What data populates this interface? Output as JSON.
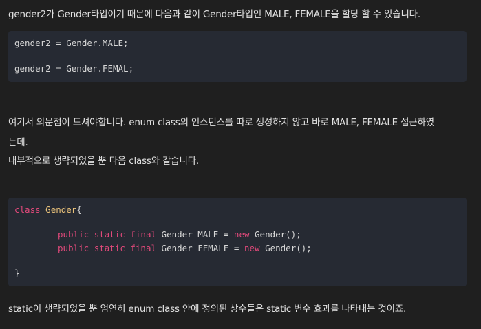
{
  "paragraphs": {
    "p1": "gender2가 Gender타입이기 때문에 다음과 같이 Gender타입인 MALE, FEMALE을 할당 할 수 있습니다.",
    "p2_line1": "여기서 의문점이 드셔야합니다. enum class의 인스턴스를 따로 생성하지 않고 바로 MALE, FEMALE 접근하였",
    "p2_line2": "는데.",
    "p2_line3": "내부적으로 생략되었을 뿐 다음 class와 같습니다.",
    "p3": "static이 생략되었을 뿐 엄연히 enum class 안에 정의된 상수들은 static 변수 효과를 나타내는 것이죠."
  },
  "code1": {
    "lines": [
      "gender2 = Gender.MALE;",
      "gender2 = Gender.FEMAL;"
    ]
  },
  "code2": {
    "kw_class": "class",
    "class_name": "Gender",
    "open_brace": "{",
    "line_male": {
      "kw_public": "public",
      "kw_static": "static",
      "kw_final": "final",
      "type": "Gender",
      "rest_before_new": "MALE = ",
      "kw_new": "new",
      "rest_after_new": "Gender();"
    },
    "line_female": {
      "kw_public": "public",
      "kw_static": "static",
      "kw_final": "final",
      "type": "Gender",
      "rest_before_new": "FEMALE = ",
      "kw_new": "new",
      "rest_after_new": "Gender();"
    },
    "close_brace": "}"
  },
  "colors": {
    "background": "#1f1f1f",
    "code_background": "#262a33",
    "keyword": "#e0497a",
    "class_name": "#e8c17a"
  }
}
